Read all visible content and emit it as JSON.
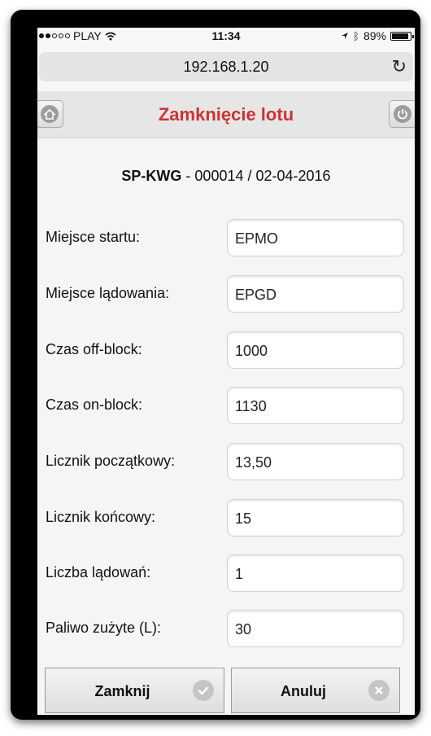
{
  "status": {
    "carrier": "PLAY",
    "time": "11:34",
    "battery": "89%"
  },
  "browser": {
    "url": "192.168.1.20"
  },
  "header": {
    "title": "Zamknięcie lotu"
  },
  "flight": {
    "registration": "SP-KWG",
    "details": " - 000014 / 02-04-2016"
  },
  "form": {
    "fields": [
      {
        "label": "Miejsce startu:",
        "value": "EPMO"
      },
      {
        "label": "Miejsce lądowania:",
        "value": "EPGD"
      },
      {
        "label": "Czas off-block:",
        "value": "1000"
      },
      {
        "label": "Czas on-block:",
        "value": "1130"
      },
      {
        "label": "Licznik początkowy:",
        "value": "13,50"
      },
      {
        "label": "Licznik końcowy:",
        "value": "15"
      },
      {
        "label": "Liczba lądowań:",
        "value": "1"
      },
      {
        "label": "Paliwo zużyte (L):",
        "value": "30"
      }
    ]
  },
  "actions": {
    "close_label": "Zamknij",
    "cancel_label": "Anuluj"
  },
  "colors": {
    "title": "#cc3333",
    "background": "#f5f5f5"
  }
}
